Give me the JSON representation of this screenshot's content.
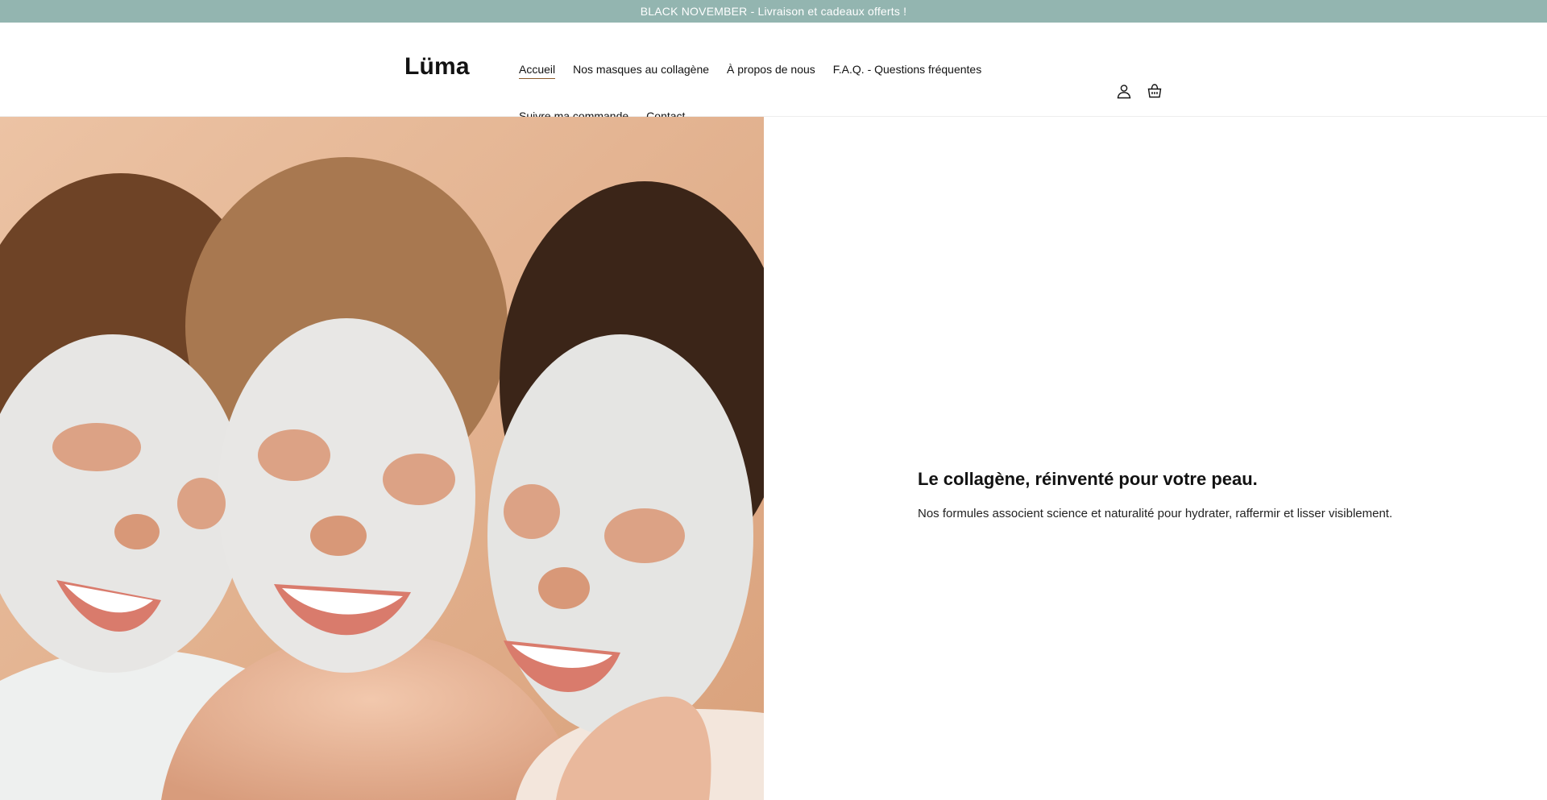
{
  "announcement": {
    "text": "BLACK NOVEMBER - Livraison et cadeaux offerts !",
    "background": "#93b5b0"
  },
  "header": {
    "logo": "Lüma",
    "nav": [
      {
        "label": "Accueil",
        "active": true
      },
      {
        "label": "Nos masques au collagène",
        "active": false
      },
      {
        "label": "À propos de nous",
        "active": false
      },
      {
        "label": "F.A.Q. - Questions fréquentes",
        "active": false
      },
      {
        "label": "Suivre ma commande",
        "active": false
      },
      {
        "label": "Contact",
        "active": false
      }
    ],
    "icons": [
      "account-icon",
      "cart-icon"
    ]
  },
  "hero": {
    "image": "three-women-collagen-masks-photo",
    "title": "Le collagène, réinventé pour votre peau.",
    "subtitle": "Nos formules associent science et naturalité pour hydrater, raffermir et lisser visiblement."
  }
}
